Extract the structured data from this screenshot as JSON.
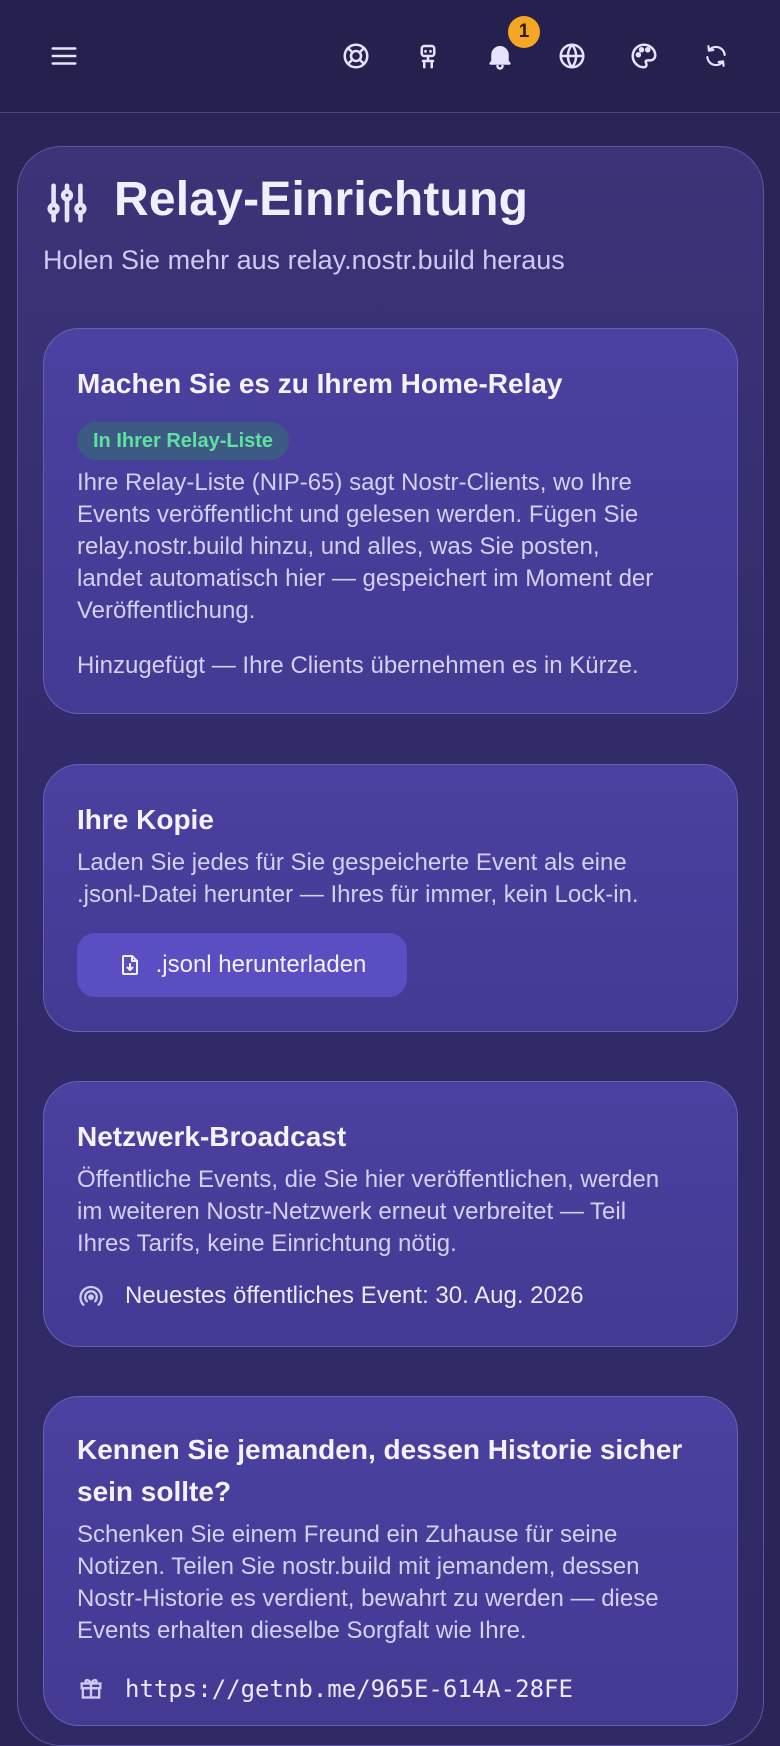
{
  "topbar": {
    "icons": [
      "menu-icon",
      "lifebuoy-icon",
      "robot-icon",
      "bell-icon",
      "globe-icon",
      "palette-icon",
      "refresh-icon"
    ],
    "notification_count": "1",
    "badge_color": "#f5a623"
  },
  "header": {
    "icon": "sliders-icon",
    "title": "Relay-Einrichtung",
    "subtitle": "Holen Sie mehr aus relay.nostr.build heraus"
  },
  "cards": {
    "home_relay": {
      "title": "Machen Sie es zu Ihrem Home-Relay",
      "badge": "In Ihrer Relay-Liste",
      "badge_color": "#5ee2a0",
      "description_lines": [
        "Ihre Relay-Liste (NIP-65) sagt Nostr-Clients, wo Ihre",
        "Events veröffentlicht und gelesen werden. Fügen Sie",
        "relay.nostr.build hinzu, und alles, was Sie posten,",
        "landet automatisch hier — gespeichert im Moment der",
        "Veröffentlichung."
      ],
      "status": "Hinzugefügt — Ihre Clients übernehmen es in Kürze."
    },
    "copy": {
      "title": "Ihre Kopie",
      "description_lines": [
        "Laden Sie jedes für Sie gespeicherte Event als eine",
        ".jsonl-Datei herunter — Ihres für immer, kein Lock-in."
      ],
      "button_label": ".jsonl herunterladen",
      "button_icon": "file-download-icon"
    },
    "broadcast": {
      "title": "Netzwerk-Broadcast",
      "description_lines": [
        "Öffentliche Events, die Sie hier veröffentlichen, werden",
        "im weiteren Nostr-Netzwerk erneut verbreitet — Teil",
        "Ihres Tarifs, keine Einrichtung nötig."
      ],
      "status_icon": "broadcast-icon",
      "status": "Neuestes öffentliches Event: 30. Aug. 2026"
    },
    "gift": {
      "title_lines": [
        "Kennen Sie jemanden, dessen Historie sicher",
        "sein sollte?"
      ],
      "description_lines": [
        "Schenken Sie einem Freund ein Zuhause für seine",
        "Notizen. Teilen Sie nostr.build mit jemandem, dessen",
        "Nostr-Historie es verdient, bewahrt zu werden — diese",
        "Events erhalten dieselbe Sorgfalt wie Ihre."
      ],
      "link_icon": "gift-icon",
      "link": "https://getnb.me/965E-614A-28FE"
    }
  }
}
